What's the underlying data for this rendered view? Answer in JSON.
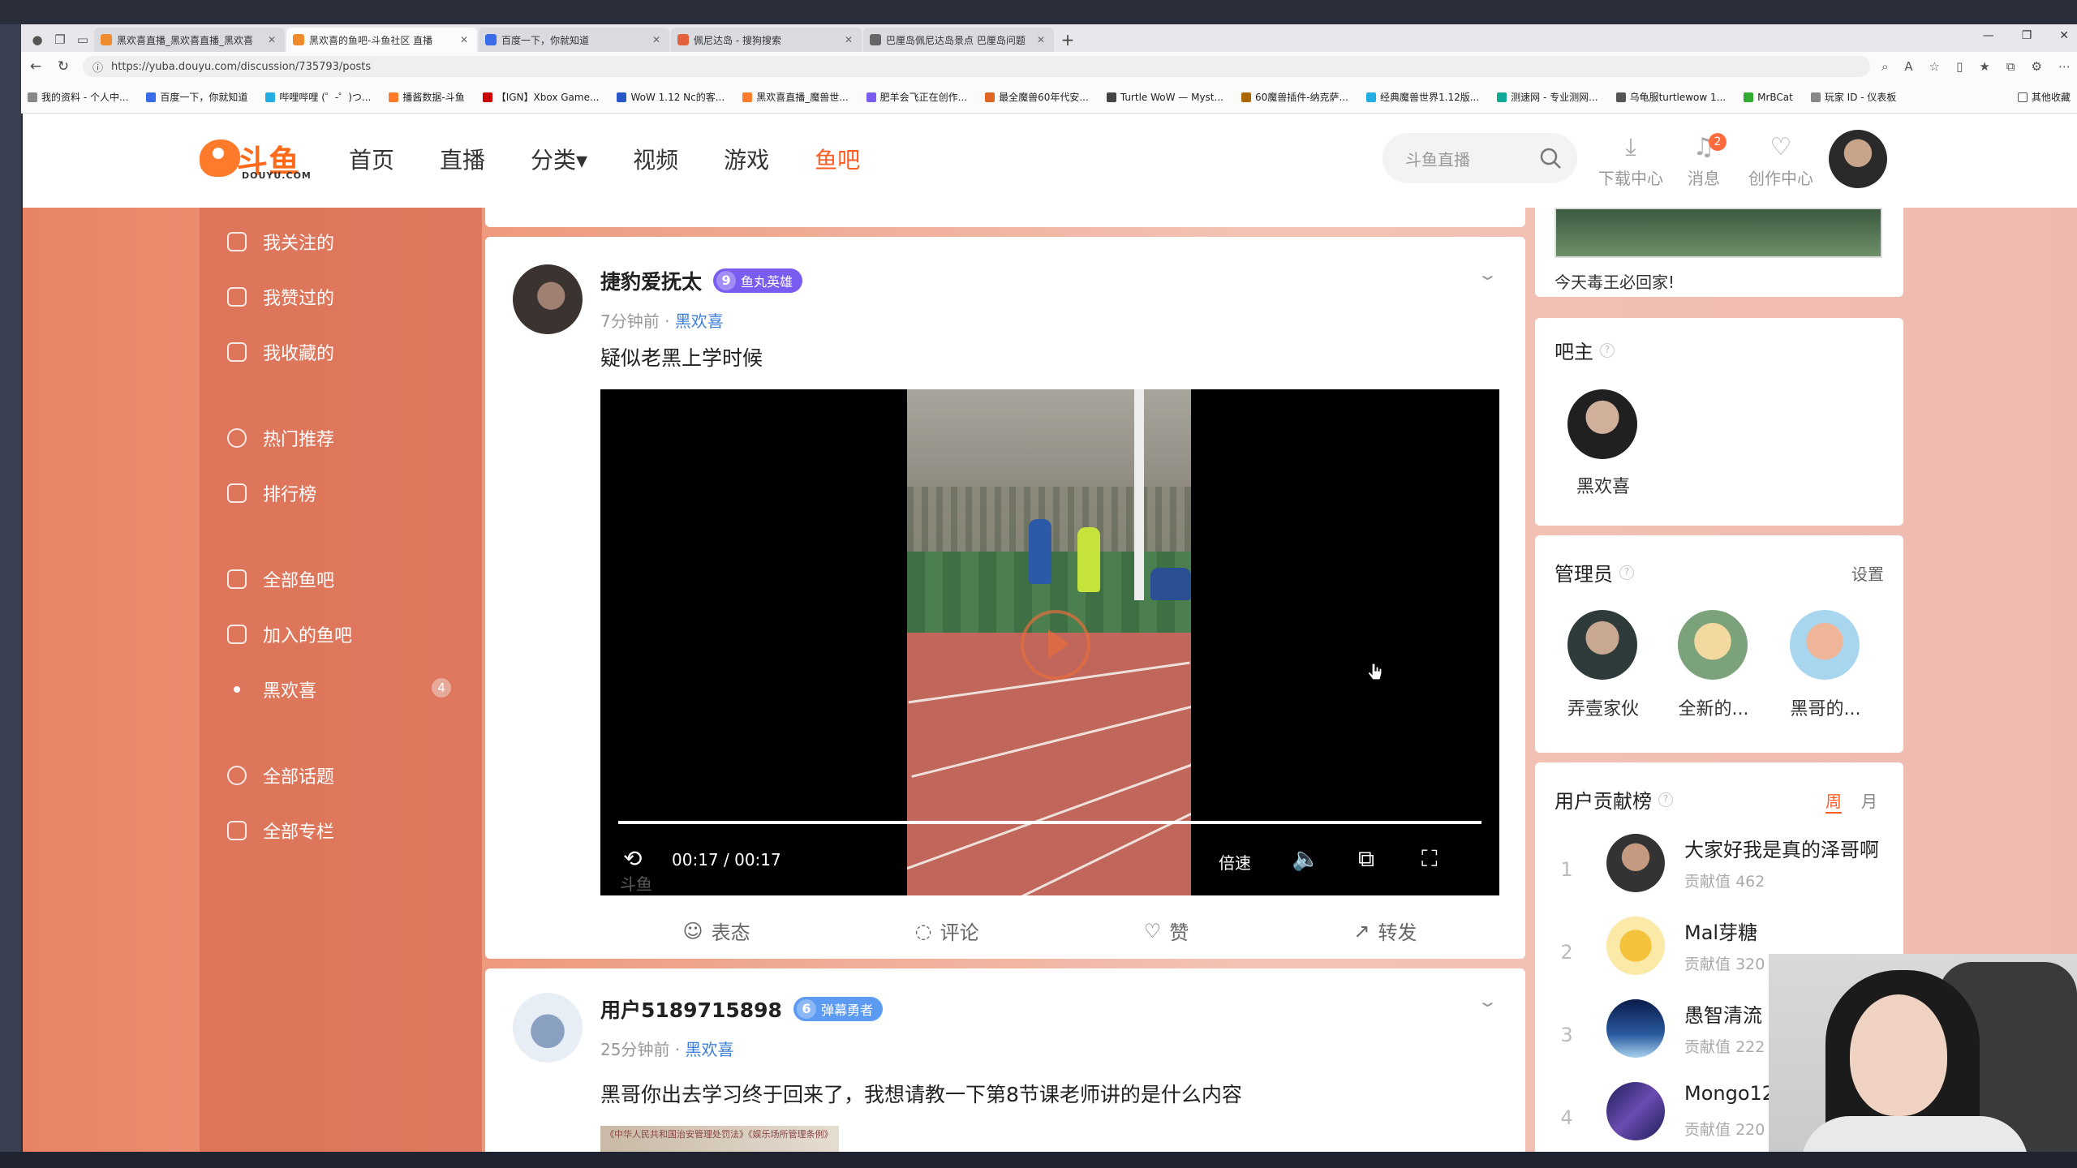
{
  "browser": {
    "tabs": [
      {
        "title": "黑欢喜直播_黑欢喜直播_黑欢喜"
      },
      {
        "title": "黑欢喜的鱼吧-斗鱼社区 直播"
      },
      {
        "title": "百度一下，你就知道"
      },
      {
        "title": "佩尼达岛 - 搜狗搜索"
      },
      {
        "title": "巴厘岛佩尼达岛景点 巴厘岛问题"
      }
    ],
    "url": "https://yuba.douyu.com/discussion/735793/posts",
    "bookmarks": [
      "我的资料 - 个人中...",
      "百度一下，你就知道",
      "哔哩哔哩 (゜-゜)つ...",
      "播酱数据-斗鱼",
      "【IGN】Xbox Game...",
      "WoW 1.12 Nc的客...",
      "黑欢喜直播_魔兽世...",
      "肥羊会飞正在创作...",
      "最全魔兽60年代安...",
      "Turtle WoW — Myst...",
      "60魔兽插件-纳克萨...",
      "经典魔兽世界1.12版...",
      "测速网 - 专业测网...",
      "乌龟服turtlewow 1...",
      "MrBCat",
      "玩家 ID - 仪表板"
    ],
    "other_bookmarks": "其他收藏"
  },
  "header": {
    "logo_text": "斗鱼",
    "logo_sub": "DOUYU.COM",
    "nav": [
      {
        "label": "首页"
      },
      {
        "label": "直播"
      },
      {
        "label": "分类▾"
      },
      {
        "label": "视频"
      },
      {
        "label": "游戏"
      },
      {
        "label": "鱼吧"
      }
    ],
    "search_placeholder": "斗鱼直播",
    "icons": [
      {
        "label": "下载中心",
        "icon": "download-icon"
      },
      {
        "label": "消息",
        "icon": "bell-icon",
        "badge": "2"
      },
      {
        "label": "创作中心",
        "icon": "lightbulb-icon"
      }
    ]
  },
  "sidebar": {
    "items": [
      {
        "label": "我关注的"
      },
      {
        "label": "我赞过的"
      },
      {
        "label": "我收藏的"
      },
      {
        "label": "热门推荐"
      },
      {
        "label": "排行榜"
      },
      {
        "label": "全部鱼吧"
      },
      {
        "label": "加入的鱼吧"
      },
      {
        "label": "黑欢喜",
        "badge": "4"
      },
      {
        "label": "全部话题"
      },
      {
        "label": "全部专栏"
      }
    ]
  },
  "posts": [
    {
      "user": "捷豹爱抚太",
      "level": "9",
      "level_title": "鱼丸英雄",
      "time": "7分钟前",
      "sep": " · ",
      "bar": "黑欢喜",
      "text": "疑似老黑上学时候",
      "video": {
        "time": "00:17 / 00:17",
        "speed": "倍速",
        "watermark": "斗鱼",
        "progress": 1.0
      },
      "actions": [
        "表态",
        "评论",
        "赞",
        "转发"
      ]
    },
    {
      "user": "用户5189715898",
      "level": "6",
      "level_title": "弹幕勇者",
      "time": "25分钟前",
      "sep": " · ",
      "bar": "黑欢喜",
      "text": "黑哥你出去学习终于回来了，我想请教一下第8节课老师讲的是什么内容",
      "thumb_text": "《中华人民共和国治安管理处罚法》《娱乐场所管理条例》"
    }
  ],
  "right": {
    "top_caption": "今天毒王必回家!",
    "owner_title": "吧主",
    "owner": {
      "name": "黑欢喜"
    },
    "admins_title": "管理员",
    "admins_setting": "设置",
    "admins": [
      {
        "name": "弄壹家伙"
      },
      {
        "name": "全新的..."
      },
      {
        "name": "黑哥的..."
      }
    ],
    "contrib_title": "用户贡献榜",
    "contrib_tabs": [
      "周",
      "月"
    ],
    "contrib_label": "贡献值",
    "contributors": [
      {
        "rank": "1",
        "name": "大家好我是真的泽哥啊",
        "score": "462"
      },
      {
        "rank": "2",
        "name": "Mal芽糖",
        "score": "320"
      },
      {
        "rank": "3",
        "name": "愚智清流",
        "score": "222"
      },
      {
        "rank": "4",
        "name": "Mongo12",
        "score": "220"
      }
    ]
  },
  "colors": {
    "accent": "#ff5d23",
    "link": "#3d7fd9",
    "badge9": "#7b5cf0",
    "badge6": "#5b9bf2"
  }
}
